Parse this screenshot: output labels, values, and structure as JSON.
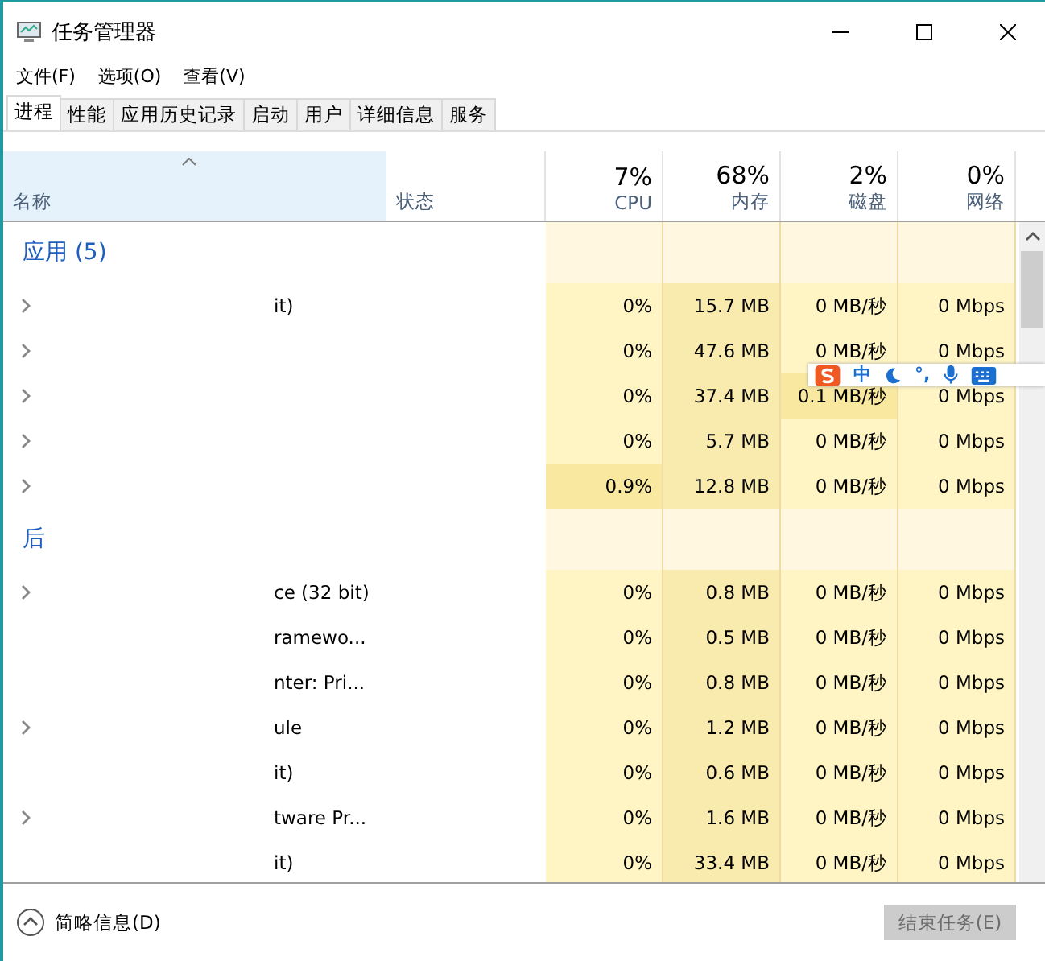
{
  "window": {
    "title": "任务管理器"
  },
  "menu": [
    "文件(F)",
    "选项(O)",
    "查看(V)"
  ],
  "tabs": [
    {
      "label": "进程",
      "selected": true
    },
    {
      "label": "性能",
      "selected": false
    },
    {
      "label": "应用历史记录",
      "selected": false
    },
    {
      "label": "启动",
      "selected": false
    },
    {
      "label": "用户",
      "selected": false
    },
    {
      "label": "详细信息",
      "selected": false
    },
    {
      "label": "服务",
      "selected": false
    }
  ],
  "columns": [
    {
      "kind": "name",
      "label": "名称",
      "sorted": true
    },
    {
      "kind": "status",
      "label": "状态"
    },
    {
      "kind": "metric",
      "total": "7%",
      "label": "CPU"
    },
    {
      "kind": "metric",
      "total": "68%",
      "label": "内存"
    },
    {
      "kind": "metric",
      "total": "2%",
      "label": "磁盘"
    },
    {
      "kind": "metric",
      "total": "0%",
      "label": "网络"
    }
  ],
  "groups": [
    {
      "title": "应用 (5)",
      "rows": [
        {
          "name": "it)",
          "expandable": true,
          "cpu": "0%",
          "memory": "15.7 MB",
          "disk": "0 MB/秒",
          "network": "0 Mbps",
          "cpu_hot": false,
          "disk_hot": false
        },
        {
          "name": "",
          "expandable": true,
          "cpu": "0%",
          "memory": "47.6 MB",
          "disk": "0 MB/秒",
          "network": "0 Mbps",
          "cpu_hot": false,
          "disk_hot": false
        },
        {
          "name": "",
          "expandable": true,
          "cpu": "0%",
          "memory": "37.4 MB",
          "disk": "0.1 MB/秒",
          "network": "0 Mbps",
          "cpu_hot": false,
          "disk_hot": true
        },
        {
          "name": "",
          "expandable": true,
          "cpu": "0%",
          "memory": "5.7 MB",
          "disk": "0 MB/秒",
          "network": "0 Mbps",
          "cpu_hot": false,
          "disk_hot": false
        },
        {
          "name": "",
          "expandable": true,
          "cpu": "0.9%",
          "memory": "12.8 MB",
          "disk": "0 MB/秒",
          "network": "0 Mbps",
          "cpu_hot": true,
          "disk_hot": false
        }
      ]
    },
    {
      "title": "后",
      "rows": [
        {
          "name": "ce (32 bit)",
          "expandable": true,
          "cpu": "0%",
          "memory": "0.8 MB",
          "disk": "0 MB/秒",
          "network": "0 Mbps",
          "cpu_hot": false,
          "disk_hot": false
        },
        {
          "name": "ramewo...",
          "expandable": false,
          "cpu": "0%",
          "memory": "0.5 MB",
          "disk": "0 MB/秒",
          "network": "0 Mbps",
          "cpu_hot": false,
          "disk_hot": false
        },
        {
          "name": "nter: Pri...",
          "expandable": false,
          "cpu": "0%",
          "memory": "0.8 MB",
          "disk": "0 MB/秒",
          "network": "0 Mbps",
          "cpu_hot": false,
          "disk_hot": false
        },
        {
          "name": "ule",
          "expandable": true,
          "cpu": "0%",
          "memory": "1.2 MB",
          "disk": "0 MB/秒",
          "network": "0 Mbps",
          "cpu_hot": false,
          "disk_hot": false
        },
        {
          "name": "it)",
          "expandable": false,
          "cpu": "0%",
          "memory": "0.6 MB",
          "disk": "0 MB/秒",
          "network": "0 Mbps",
          "cpu_hot": false,
          "disk_hot": false
        },
        {
          "name": "tware Pr...",
          "expandable": true,
          "cpu": "0%",
          "memory": "1.6 MB",
          "disk": "0 MB/秒",
          "network": "0 Mbps",
          "cpu_hot": false,
          "disk_hot": false
        },
        {
          "name": "it)",
          "expandable": false,
          "cpu": "0%",
          "memory": "33.4 MB",
          "disk": "0 MB/秒",
          "network": "0 Mbps",
          "cpu_hot": false,
          "disk_hot": false
        }
      ]
    }
  ],
  "ime": {
    "mode": "中",
    "punctuation": "°,"
  },
  "footer": {
    "details": "简略信息(D)",
    "end_task": {
      "label": "结束任务(E)",
      "disabled": true
    }
  }
}
